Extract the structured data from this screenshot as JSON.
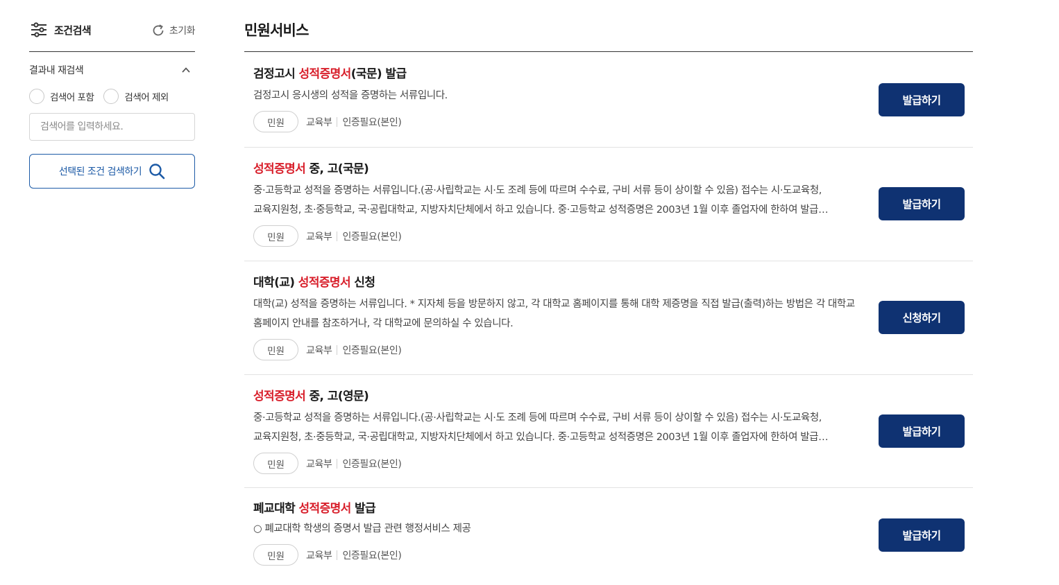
{
  "sidebar": {
    "title": "조건검색",
    "reset_label": "초기화",
    "refine_label": "결과내 재검색",
    "radio_include": "검색어 포함",
    "radio_exclude": "검색어 제외",
    "input_placeholder": "검색어를 입력하세요.",
    "search_button": "선택된 조건 검색하기"
  },
  "main": {
    "title": "민원서비스",
    "items": [
      {
        "title_pre": "검정고시 ",
        "title_hl": "성적증명서",
        "title_post": "(국문) 발급",
        "desc": "검정고시 응시생의 성적을 증명하는 서류입니다.",
        "tag": "민원",
        "org": "교육부",
        "auth": "인증필요(본인)",
        "action": "발급하기"
      },
      {
        "title_pre": "",
        "title_hl": "성적증명서",
        "title_post": " 중, 고(국문)",
        "desc": "중·고등학교 성적을 증명하는 서류입니다.(공·사립학교는 시·도 조례 등에 따르며 수수료, 구비 서류 등이 상이할 수 있음) 접수는 시·도교육청, 교육지원청, 초·중등학교, 국·공립대학교, 지방자치단체에서 하고 있습니다. 중·고등학교 성적증명은 2003년 1월 이후 졸업자에 한하여 발급 가능합니다.",
        "tag": "민원",
        "org": "교육부",
        "auth": "인증필요(본인)",
        "action": "발급하기"
      },
      {
        "title_pre": "대학(교) ",
        "title_hl": "성적증명서",
        "title_post": " 신청",
        "desc": "대학(교) 성적을 증명하는 서류입니다. * 지자체 등을 방문하지 않고, 각 대학교 홈페이지를 통해 대학 제증명을 직접 발급(출력)하는 방법은 각 대학교 홈페이지 안내를 참조하거나, 각 대학교에 문의하실 수 있습니다.",
        "tag": "민원",
        "org": "교육부",
        "auth": "인증필요(본인)",
        "action": "신청하기"
      },
      {
        "title_pre": "",
        "title_hl": "성적증명서",
        "title_post": " 중, 고(영문)",
        "desc": "중·고등학교 성적을 증명하는 서류입니다.(공·사립학교는 시·도 조례 등에 따르며 수수료, 구비 서류 등이 상이할 수 있음) 접수는 시·도교육청, 교육지원청, 초·중등학교, 국·공립대학교, 지방자치단체에서 하고 있습니다. 중·고등학교 성적증명은 2003년 1월 이후 졸업자에 한하여 발급 가능합니다.",
        "tag": "민원",
        "org": "교육부",
        "auth": "인증필요(본인)",
        "action": "발급하기"
      },
      {
        "title_pre": "폐교대학 ",
        "title_hl": "성적증명서",
        "title_post": " 발급",
        "desc": "○ 폐교대학 학생의 증명서 발급 관련 행정서비스 제공",
        "tag": "민원",
        "org": "교육부",
        "auth": "인증필요(본인)",
        "action": "발급하기"
      }
    ]
  },
  "colors": {
    "highlight": "#d81e2a",
    "button_bg": "#0f3272",
    "accent_blue": "#1c5aa6"
  }
}
